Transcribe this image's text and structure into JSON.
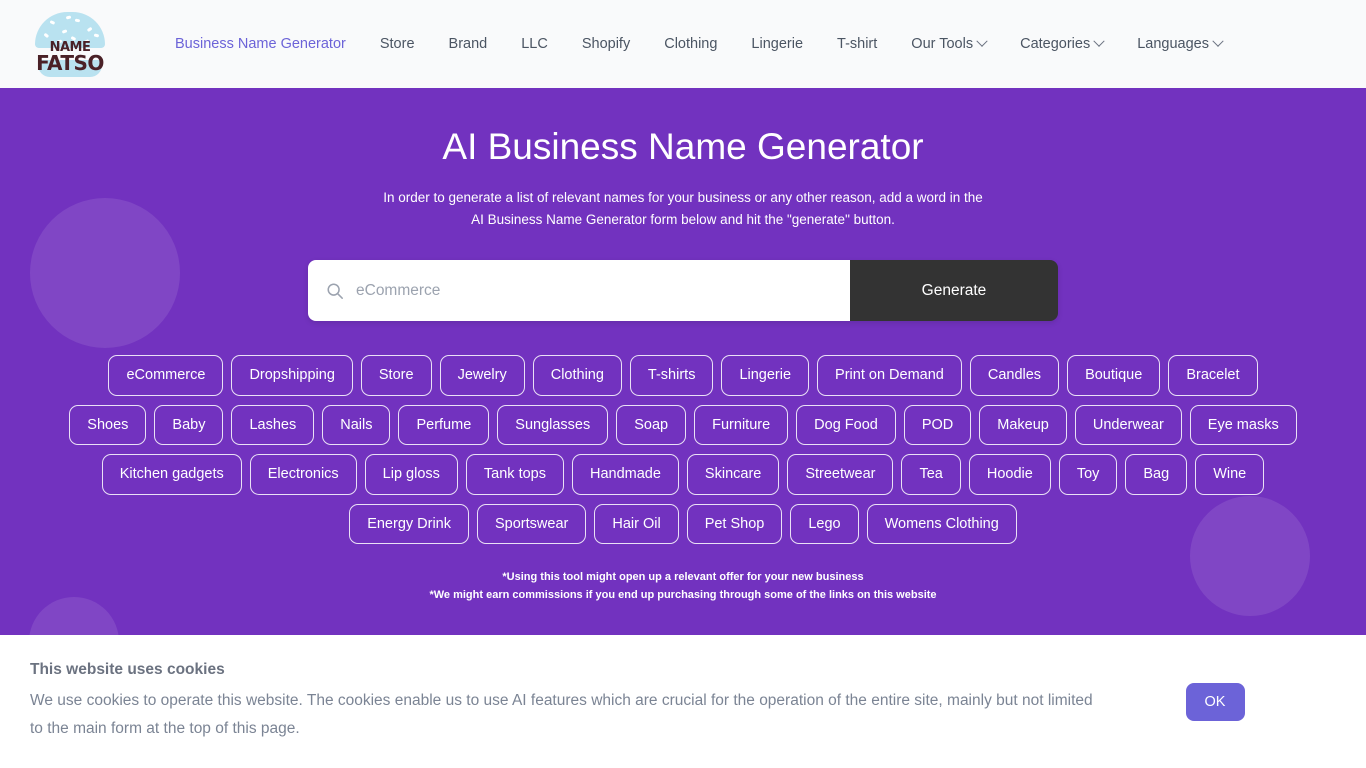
{
  "header": {
    "logo": {
      "line1": "NAME",
      "line2": "FATSO",
      "icon": "burger-logo-icon"
    },
    "nav": [
      {
        "label": "Business Name Generator",
        "active": true,
        "dropdown": false
      },
      {
        "label": "Store",
        "active": false,
        "dropdown": false
      },
      {
        "label": "Brand",
        "active": false,
        "dropdown": false
      },
      {
        "label": "LLC",
        "active": false,
        "dropdown": false
      },
      {
        "label": "Shopify",
        "active": false,
        "dropdown": false
      },
      {
        "label": "Clothing",
        "active": false,
        "dropdown": false
      },
      {
        "label": "Lingerie",
        "active": false,
        "dropdown": false
      },
      {
        "label": "T-shirt",
        "active": false,
        "dropdown": false
      },
      {
        "label": "Our Tools",
        "active": false,
        "dropdown": true
      },
      {
        "label": "Categories",
        "active": false,
        "dropdown": true
      },
      {
        "label": "Languages",
        "active": false,
        "dropdown": true
      }
    ]
  },
  "hero": {
    "title": "AI Business Name Generator",
    "subtitle_line1": "In order to generate a list of relevant names for your business or any other reason, add a word in the",
    "subtitle_line2": "AI Business Name Generator form below and hit the \"generate\" button.",
    "background_color": "#7232bf"
  },
  "search": {
    "icon": "search-icon",
    "placeholder": "eCommerce",
    "value": "",
    "button_label": "Generate",
    "button_color": "#333333"
  },
  "tags": [
    "eCommerce",
    "Dropshipping",
    "Store",
    "Jewelry",
    "Clothing",
    "T-shirts",
    "Lingerie",
    "Print on Demand",
    "Candles",
    "Boutique",
    "Bracelet",
    "Shoes",
    "Baby",
    "Lashes",
    "Nails",
    "Perfume",
    "Sunglasses",
    "Soap",
    "Furniture",
    "Dog Food",
    "POD",
    "Makeup",
    "Underwear",
    "Eye masks",
    "Kitchen gadgets",
    "Electronics",
    "Lip gloss",
    "Tank tops",
    "Handmade",
    "Skincare",
    "Streetwear",
    "Tea",
    "Hoodie",
    "Toy",
    "Bag",
    "Wine",
    "Energy Drink",
    "Sportswear",
    "Hair Oil",
    "Pet Shop",
    "Lego",
    "Womens Clothing"
  ],
  "disclaimer": {
    "line1": "*Using this tool might open up a relevant offer for your new business",
    "line2": "*We might earn commissions if you end up purchasing through some of the links on this website"
  },
  "cookie_banner": {
    "title": "This website uses cookies",
    "body": "We use cookies to operate this website. The cookies enable us to use AI features which are crucial for the operation of the entire site, mainly but not limited to the main form at the top of this page.",
    "ok_label": "OK",
    "ok_color": "#6c63d8"
  }
}
